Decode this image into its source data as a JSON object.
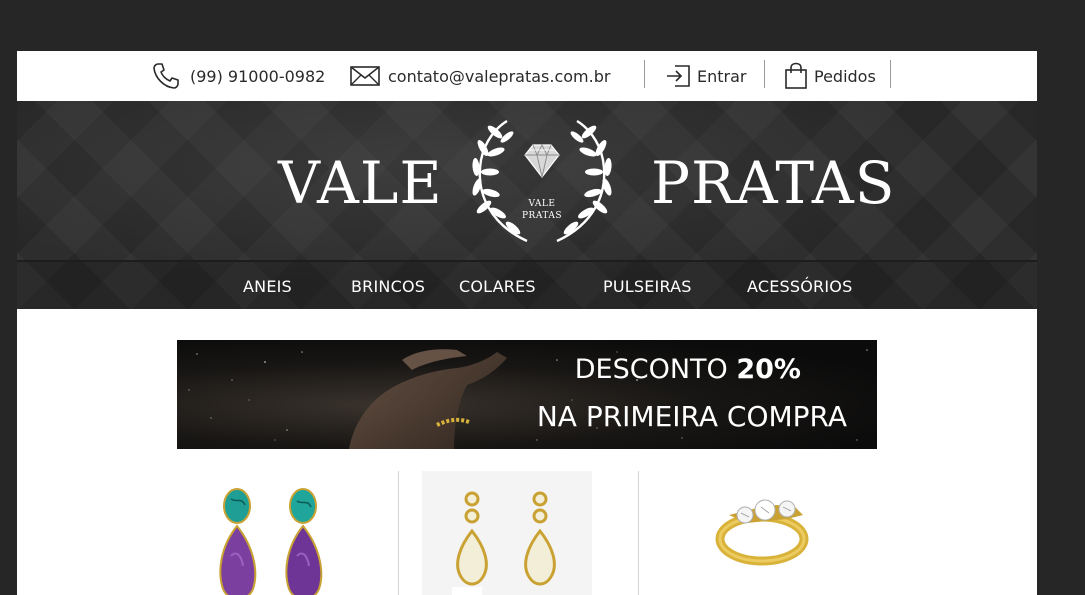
{
  "topbar": {
    "phone": "(99) 91000-0982",
    "email": "contato@valepratas.com.br",
    "login_label": "Entrar",
    "orders_label": "Pedidos",
    "icons": {
      "phone": "phone-icon",
      "email": "envelope-icon",
      "login": "login-icon",
      "orders": "shopping-bag-icon"
    }
  },
  "header": {
    "brand_left": "VALE",
    "brand_right": "PRATAS",
    "logo_line1": "VALE",
    "logo_line2": "PRATAS"
  },
  "nav": {
    "items": [
      "ANEIS",
      "BRINCOS",
      "COLARES",
      "PULSEIRAS",
      "ACESSÓRIOS"
    ]
  },
  "banner": {
    "line1_prefix": "DESCONTO ",
    "line1_strong": "20%",
    "line2": "NA PRIMEIRA COMPRA"
  },
  "colors": {
    "background": "#262626",
    "header": "#2b2b2b",
    "gold": "#d9b23a",
    "amethyst": "#7b3fa0",
    "turquoise": "#1fa59a"
  }
}
